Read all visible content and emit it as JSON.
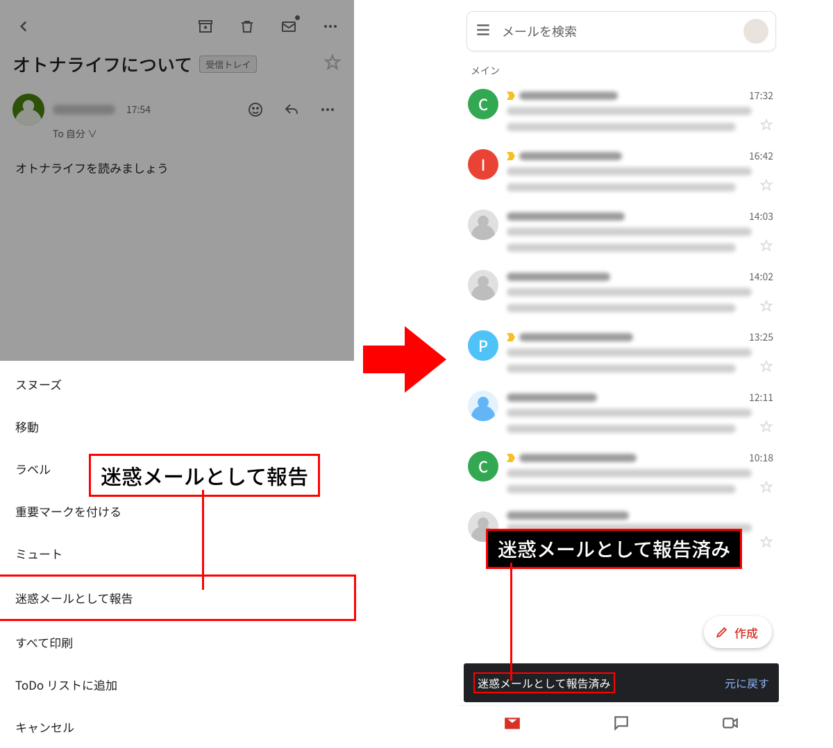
{
  "left": {
    "subject": "オトナライフについて",
    "inbox_badge": "受信トレイ",
    "time": "17:54",
    "to_line": "To 自分 ∨",
    "body": "オトナライフを読みましょう",
    "sheet": {
      "snooze": "スヌーズ",
      "move": "移動",
      "label": "ラベル",
      "mark_important": "重要マークを付ける",
      "mute": "ミュート",
      "report_spam": "迷惑メールとして報告",
      "print_all": "すべて印刷",
      "add_todo": "ToDo リストに追加",
      "cancel": "キャンセル"
    }
  },
  "callout_left": "迷惑メールとして報告",
  "callout_right": "迷惑メールとして報告済み",
  "right": {
    "search_placeholder": "メールを検索",
    "main_label": "メイン",
    "fab": "作成",
    "toast_msg": "迷惑メールとして報告済み",
    "toast_undo": "元に戻す",
    "rows": [
      {
        "avatar": "C",
        "color": "green",
        "important": true,
        "time": "17:32"
      },
      {
        "avatar": "I",
        "color": "red",
        "important": true,
        "time": "16:42"
      },
      {
        "avatar": "",
        "color": "grey",
        "important": false,
        "time": "14:03"
      },
      {
        "avatar": "",
        "color": "grey",
        "important": false,
        "time": "14:02"
      },
      {
        "avatar": "P",
        "color": "cyan",
        "important": true,
        "time": "13:25"
      },
      {
        "avatar": "",
        "color": "blue",
        "important": false,
        "time": "12:11"
      },
      {
        "avatar": "C",
        "color": "green",
        "important": true,
        "time": "10:18"
      },
      {
        "avatar": "",
        "color": "grey",
        "important": false,
        "time": ""
      }
    ]
  }
}
